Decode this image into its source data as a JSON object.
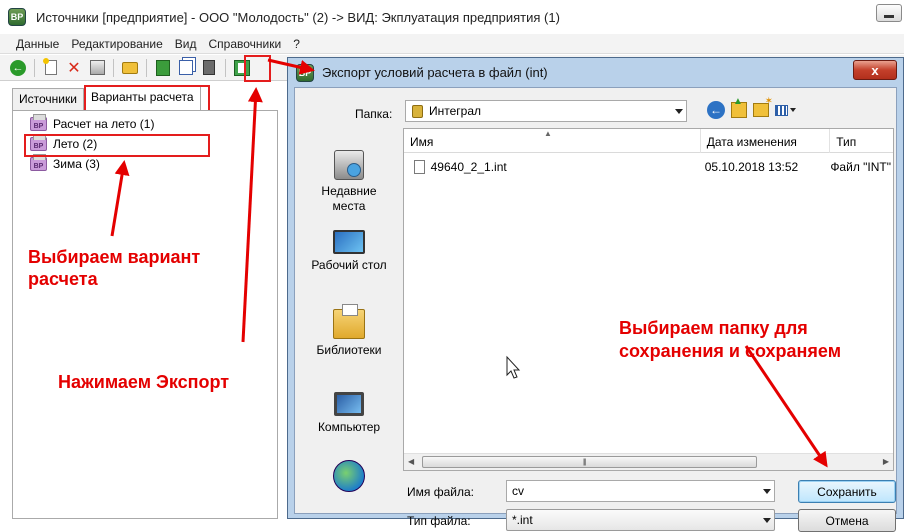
{
  "main_window": {
    "title": "Источники [предприятие] - ООО \"Молодость\" (2) -> ВИД: Экплуатация предприятия (1)",
    "app_icon": "BP"
  },
  "menu": [
    "Данные",
    "Редактирование",
    "Вид",
    "Справочники",
    "?"
  ],
  "toolbar_icons": [
    "back-icon",
    "new-icon",
    "delete-icon",
    "properties-icon",
    "open-folder-icon",
    "refresh-icon",
    "copy-icon",
    "document-icon",
    "export-icon"
  ],
  "tabs": [
    "Источники",
    "Варианты расчета"
  ],
  "tree_items": [
    {
      "label": "Расчет на лето (1)",
      "icon": "BP"
    },
    {
      "label": "Лето (2)",
      "icon": "BP"
    },
    {
      "label": "Зима (3)",
      "icon": "BP"
    }
  ],
  "annotations": {
    "select_variant": [
      "Выбираем вариант",
      "расчета"
    ],
    "press_export": "Нажимаем Экспорт",
    "choose_folder": [
      "Выбираем папку для",
      "сохранения и сохраняем"
    ]
  },
  "dialog": {
    "title": "Экспорт условий расчета в файл (int)",
    "close_label": "x",
    "folder_label": "Папка:",
    "folder_value": "Интеграл",
    "places": [
      "Недавние места",
      "Рабочий стол",
      "Библиотеки",
      "Компьютер"
    ],
    "columns": {
      "name": "Имя",
      "date": "Дата изменения",
      "type": "Тип"
    },
    "files": [
      {
        "name": "49640_2_1.int",
        "date": "05.10.2018 13:52",
        "type": "Файл \"INT\""
      }
    ],
    "filename_label": "Имя файла:",
    "filename_value": "cv",
    "filetype_label": "Тип файла:",
    "filetype_value": "*.int",
    "save_button": "Сохранить",
    "cancel_button": "Отмена"
  },
  "colors": {
    "annotation": "#e40000",
    "dialog_frame": "#b9d1ea"
  }
}
